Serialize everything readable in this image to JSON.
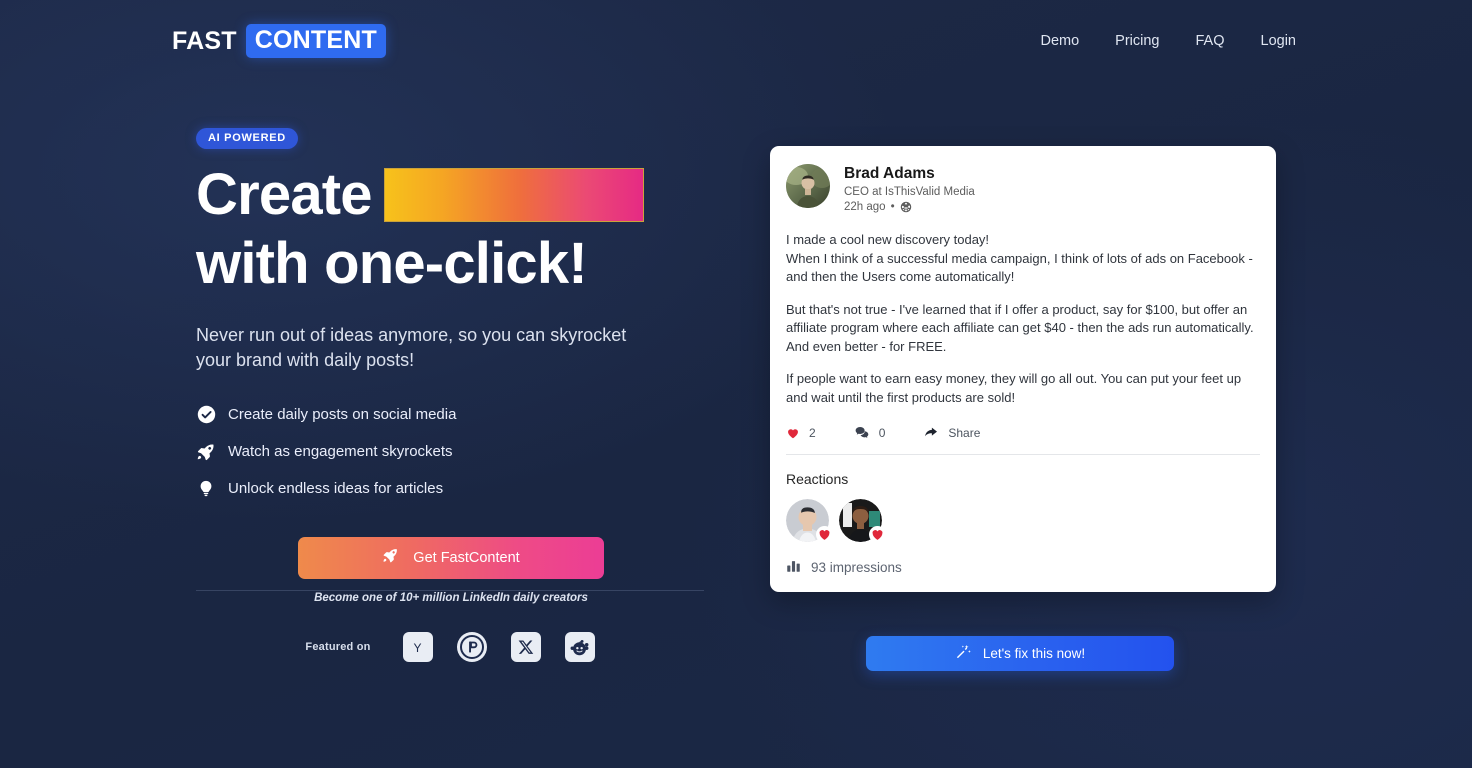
{
  "header": {
    "logo_fast": "FAST",
    "logo_content": "CONTENT",
    "nav": [
      {
        "label": "Demo"
      },
      {
        "label": "Pricing"
      },
      {
        "label": "FAQ"
      },
      {
        "label": "Login"
      }
    ]
  },
  "hero": {
    "badge": "AI POWERED",
    "title_line1": "Create",
    "title_line2": "with one-click!",
    "subtitle": "Never run out of ideas anymore, so you can skyrocket your brand with daily posts!",
    "features": [
      {
        "icon": "check-circle-icon",
        "label": "Create daily posts on social media"
      },
      {
        "icon": "rocket-icon",
        "label": "Watch as engagement skyrockets"
      },
      {
        "icon": "lightbulb-icon",
        "label": "Unlock endless ideas for articles"
      }
    ],
    "cta_label": "Get FastContent",
    "cta_icon": "rocket-icon",
    "cta_note": "Become one of 10+ million LinkedIn daily creators",
    "gradient_start": "#f7c21b",
    "gradient_end": "#e62a84"
  },
  "featured": {
    "label": "Featured on",
    "brands": [
      {
        "name": "ycombinator-icon",
        "glyph": "Y"
      },
      {
        "name": "producthunt-icon",
        "glyph": "P"
      },
      {
        "name": "x-twitter-icon",
        "glyph": "X"
      },
      {
        "name": "reddit-icon",
        "glyph": "R"
      }
    ]
  },
  "post": {
    "author_name": "Brad Adams",
    "author_title": "CEO at IsThisValid Media",
    "timestamp": "22h ago",
    "meta_separator": "•",
    "visibility_icon": "globe-icon",
    "paragraphs": [
      "I made a cool new discovery today!\nWhen I think of a successful media campaign, I think of lots of ads on Facebook - and then the Users come automatically!",
      "But that's not true - I've learned that if I offer a product, say for $100, but offer an affiliate program where each affiliate can get $40 - then the ads run automatically. And even better - for FREE.",
      "If people want to earn easy money, they will go all out. You can put your feet up and wait until the first products are sold!"
    ],
    "engagement": [
      {
        "icon": "heart-icon",
        "count": "2"
      },
      {
        "icon": "comment-icon",
        "count": "0"
      },
      {
        "icon": "share-icon",
        "count": "Share"
      }
    ],
    "reactions_title": "Reactions",
    "reaction_count": 2,
    "impressions": "93 impressions",
    "impressions_icon": "bar-chart-icon"
  },
  "fix_button": {
    "label": "Let's fix this now!",
    "icon": "magic-wand-icon",
    "color": "#2a62ef"
  }
}
